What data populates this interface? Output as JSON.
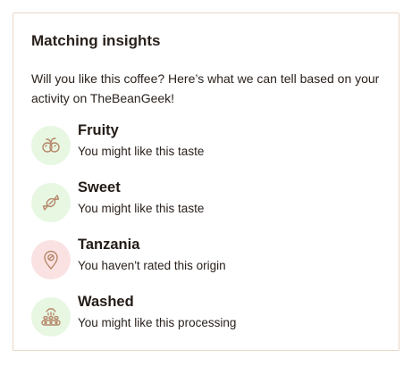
{
  "panel": {
    "title": "Matching insights",
    "intro": "Will you like this coffee? Here’s what we can tell based on your activity on TheBeanGeek!"
  },
  "insights": [
    {
      "title": "Fruity",
      "description": "You might like this taste",
      "icon": "fruit-icon",
      "tone": "green"
    },
    {
      "title": "Sweet",
      "description": "You might like this taste",
      "icon": "candy-icon",
      "tone": "green"
    },
    {
      "title": "Tanzania",
      "description": "You haven't rated this origin",
      "icon": "location-pin-icon",
      "tone": "pink"
    },
    {
      "title": "Washed",
      "description": "You might like this processing",
      "icon": "washing-process-icon",
      "tone": "green"
    }
  ],
  "colors": {
    "border": "#e9d6c6",
    "icon_stroke": "#b5876a",
    "positive_bg": "#e7f7e2",
    "neutral_bg": "#fbe2e2"
  }
}
